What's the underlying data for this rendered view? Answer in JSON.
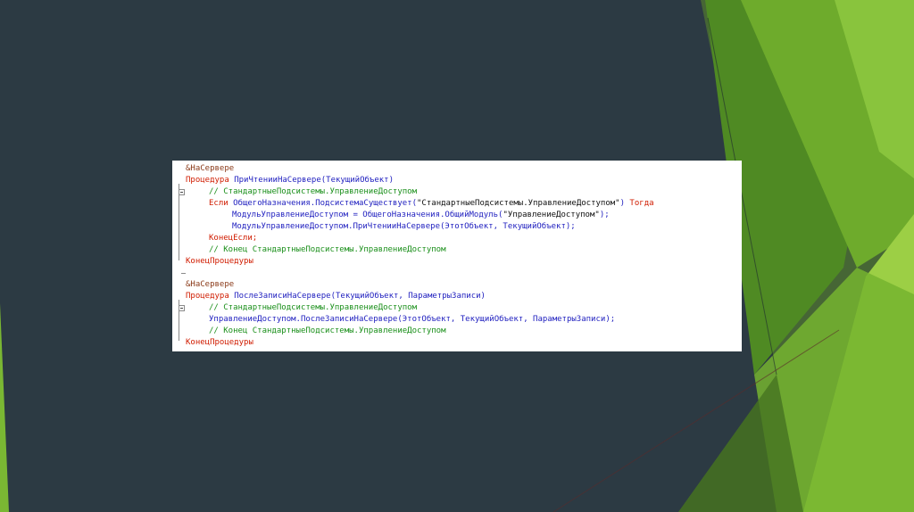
{
  "colors": {
    "background": "#2c3a43",
    "keyword": "#d01c00",
    "directive": "#8b3b1a",
    "comment": "#1a8f1a",
    "identifier": "#1f1fbf",
    "string": "#111111",
    "accent_green": "#8cc63f"
  },
  "icons": [
    "fold-minus-icon"
  ],
  "code": {
    "block1": {
      "directive": "&НаСервере",
      "proc_kw": "Процедура",
      "proc_sig": " ПриЧтенииНаСервере(ТекущийОбъект)",
      "comment1": "// СтандартныеПодсистемы.УправлениеДоступом",
      "if_kw": "Если",
      "if_cond": " ОбщегоНазначения.ПодсистемаСуществует(",
      "if_str": "\"СтандартныеПодсистемы.УправлениеДоступом\"",
      "if_close": ")",
      "then_kw": " Тогда",
      "assign": "МодульУправлениеДоступом = ОбщегоНазначения.ОбщийМодуль(",
      "assign_str": "\"УправлениеДоступом\"",
      "assign_end": ");",
      "call": "МодульУправлениеДоступом.ПриЧтенииНаСервере(ЭтотОбъект, ТекущийОбъект);",
      "endif_kw": "КонецЕсли;",
      "comment2": "// Конец СтандартныеПодсистемы.УправлениеДоступом",
      "endproc_kw": "КонецПроцедуры"
    },
    "block2": {
      "directive": "&НаСервере",
      "proc_kw": "Процедура",
      "proc_sig": " ПослеЗаписиНаСервере(ТекущийОбъект, ПараметрыЗаписи)",
      "comment1": "// СтандартныеПодсистемы.УправлениеДоступом",
      "call": "УправлениеДоступом.ПослеЗаписиНаСервере(ЭтотОбъект, ТекущийОбъект, ПараметрыЗаписи);",
      "comment2": "// Конец СтандартныеПодсистемы.УправлениеДоступом",
      "endproc_kw": "КонецПроцедуры"
    }
  }
}
